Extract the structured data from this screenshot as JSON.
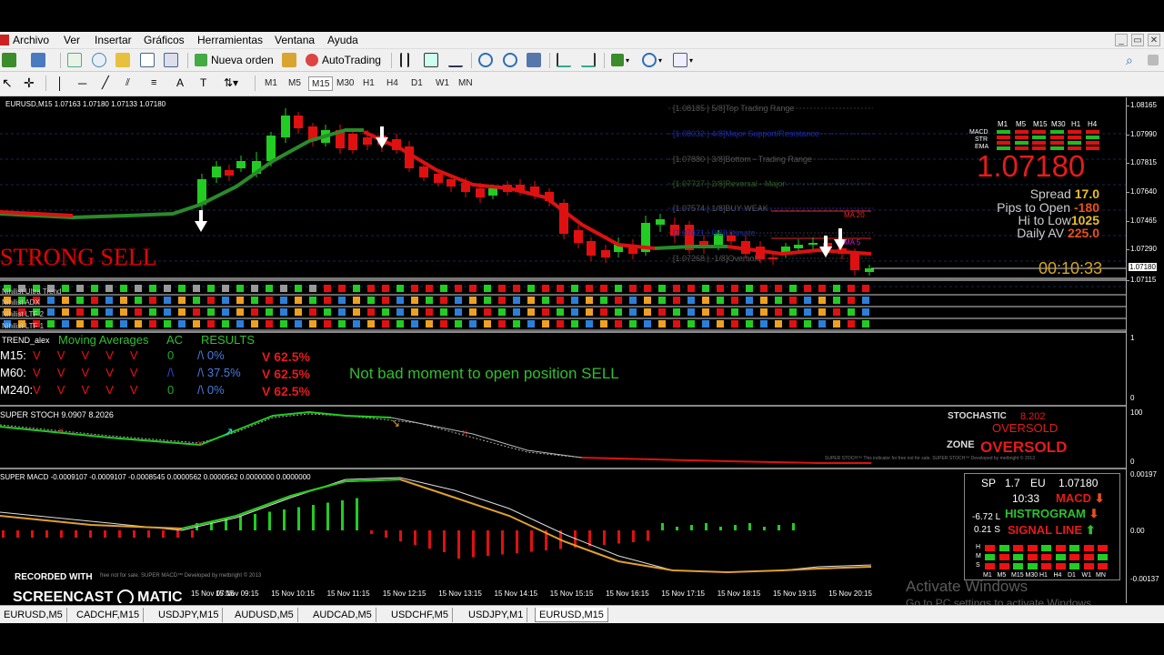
{
  "menu": [
    "Archivo",
    "Ver",
    "Insertar",
    "Gráficos",
    "Herramientas",
    "Ventana",
    "Ayuda"
  ],
  "toolbar": {
    "new_order": "Nueva orden",
    "autotrading": "AutoTrading"
  },
  "timeframes": [
    "M1",
    "M5",
    "M15",
    "M30",
    "H1",
    "H4",
    "D1",
    "W1",
    "MN"
  ],
  "active_timeframe": "M15",
  "chart_header": "EURUSD,M15  1.07163 1.07180 1.07133 1.07180",
  "strong_signal": "STRONG SELL",
  "levels": [
    {
      "text": "[1.08185 | 5/8]Top Trading Range",
      "color": "#555555"
    },
    {
      "text": "[1.08032 | 4/8]Major Support/Resistance",
      "color": "#1f2aa8"
    },
    {
      "text": "[1.07880 | 3/8]Bottom - Trading Range",
      "color": "#555555"
    },
    {
      "text": "[1.07727 | 2/8]Reversal - Major",
      "color": "#2e5a1e"
    },
    {
      "text": "[1.07574 | 1/8]BUY WEAK",
      "color": "#555555"
    },
    {
      "text": "[1.07421 | 0/8]Ultimate",
      "color": "#1f2aa8"
    },
    {
      "text": "[1.07268 | -1/8]Oversold",
      "color": "#555555"
    }
  ],
  "ma_labels": {
    "ma20": "MA 20",
    "ma5": "MA 5"
  },
  "info": {
    "mtf_headers": [
      "M1",
      "M5",
      "M15",
      "M30",
      "H1",
      "H4"
    ],
    "mtf_rows": [
      "MACD",
      "STR",
      "EMA"
    ],
    "price": "1.07180",
    "spread_label": "Spread",
    "spread_value": "17.0",
    "pips_label": "Pips to Open",
    "pips_value": "-180",
    "hilo_label": "Hi to Low",
    "hilo_value": "1025",
    "daily_label": "Daily AV",
    "daily_value": "225.0",
    "timer": "00:10:33"
  },
  "price_scale": [
    "1.08165",
    "1.07990",
    "1.07815",
    "1.07640",
    "1.07465",
    "1.07290",
    "1.07115"
  ],
  "current_price_tag": "1.07180",
  "indicators": {
    "rows": [
      "Nihilist Ultra Trend",
      "Nihilist ADX",
      "Nihilist LTF 2",
      "Nihilist LTF 1"
    ],
    "trend_name": "TREND_alex",
    "trend_headers": {
      "ma": "Moving Averages",
      "ac": "AC",
      "res": "RESULTS"
    },
    "trend_rows": [
      {
        "tf": "M15:",
        "v": "V     V     V     V     V",
        "ac": "0",
        "acpct": "/\\ 0%",
        "result": "V 62.5%"
      },
      {
        "tf": "M60:",
        "v": "V     V     V     V     V",
        "ac": "/\\",
        "acpct": "/\\ 37.5%",
        "result": "V 62.5%"
      },
      {
        "tf": "M240:",
        "v": "V     V     V     V     V",
        "ac": "0",
        "acpct": "/\\ 0%",
        "result": "V 62.5%"
      }
    ],
    "message": "Not bad moment to open position  SELL",
    "scale1": [
      "1",
      "0"
    ]
  },
  "stoch": {
    "title": "SUPER STOCH 9.0907 8.2026",
    "label": "STOCHASTIC",
    "value": "8.202",
    "state": "OVERSOLD",
    "zone_label": "ZONE",
    "zone_state": "OVERSOLD",
    "footer": "SUPER STOCH™ This indicator for free not for sale. SUPER STOCH™ Developed by metbright © 2013",
    "scale": [
      "100",
      "0"
    ]
  },
  "macd": {
    "title": "SUPER MACD -0.0009107 -0.0009107 -0.0008545 0.0000562 0.0000562 0.0000000 0.0000000",
    "footer": "free not for sale. SUPER MACD™ Developed by metbright © 2013",
    "scale": [
      "0.00197",
      "0.00",
      "-0.00137"
    ],
    "panel": {
      "sp": "SP",
      "spv": "1.7",
      "eu": "EU",
      "euv": "1.07180",
      "time": "10:33",
      "macd": "MACD",
      "hist": "HISTROGRAM",
      "sig": "SIGNAL LINE",
      "l": "-6.72 L",
      "s": "0.21 S",
      "grid_rows": [
        "H",
        "M",
        "S"
      ],
      "grid_cols": [
        "M1",
        "M5",
        "M15",
        "M30",
        "H1",
        "H4",
        "D1",
        "W1",
        "MN"
      ]
    }
  },
  "time_axis": [
    "15 Nov 09:15",
    "15 Nov 10:15",
    "15 Nov 11:15",
    "15 Nov 12:15",
    "15 Nov 13:15",
    "15 Nov 14:15",
    "15 Nov 15:15",
    "15 Nov 16:15",
    "15 Nov 17:15",
    "15 Nov 18:15",
    "15 Nov 19:15",
    "15 Nov 20:15"
  ],
  "time_axis_partial": "15 Nov 07:15",
  "tabs": [
    "EURUSD,M5",
    "CADCHF,M15",
    "USDJPY,M15",
    "AUDUSD,M5",
    "AUDCAD,M5",
    "USDCHF,M5",
    "USDJPY,M1",
    "EURUSD,M15"
  ],
  "selected_tab": "EURUSD,M15",
  "watermark": {
    "recorded": "RECORDED WITH",
    "brand": "SCREENCAST",
    "brand2": "MATIC",
    "act1": "Activate Windows",
    "act2": "Go to PC settings to activate Windows."
  }
}
